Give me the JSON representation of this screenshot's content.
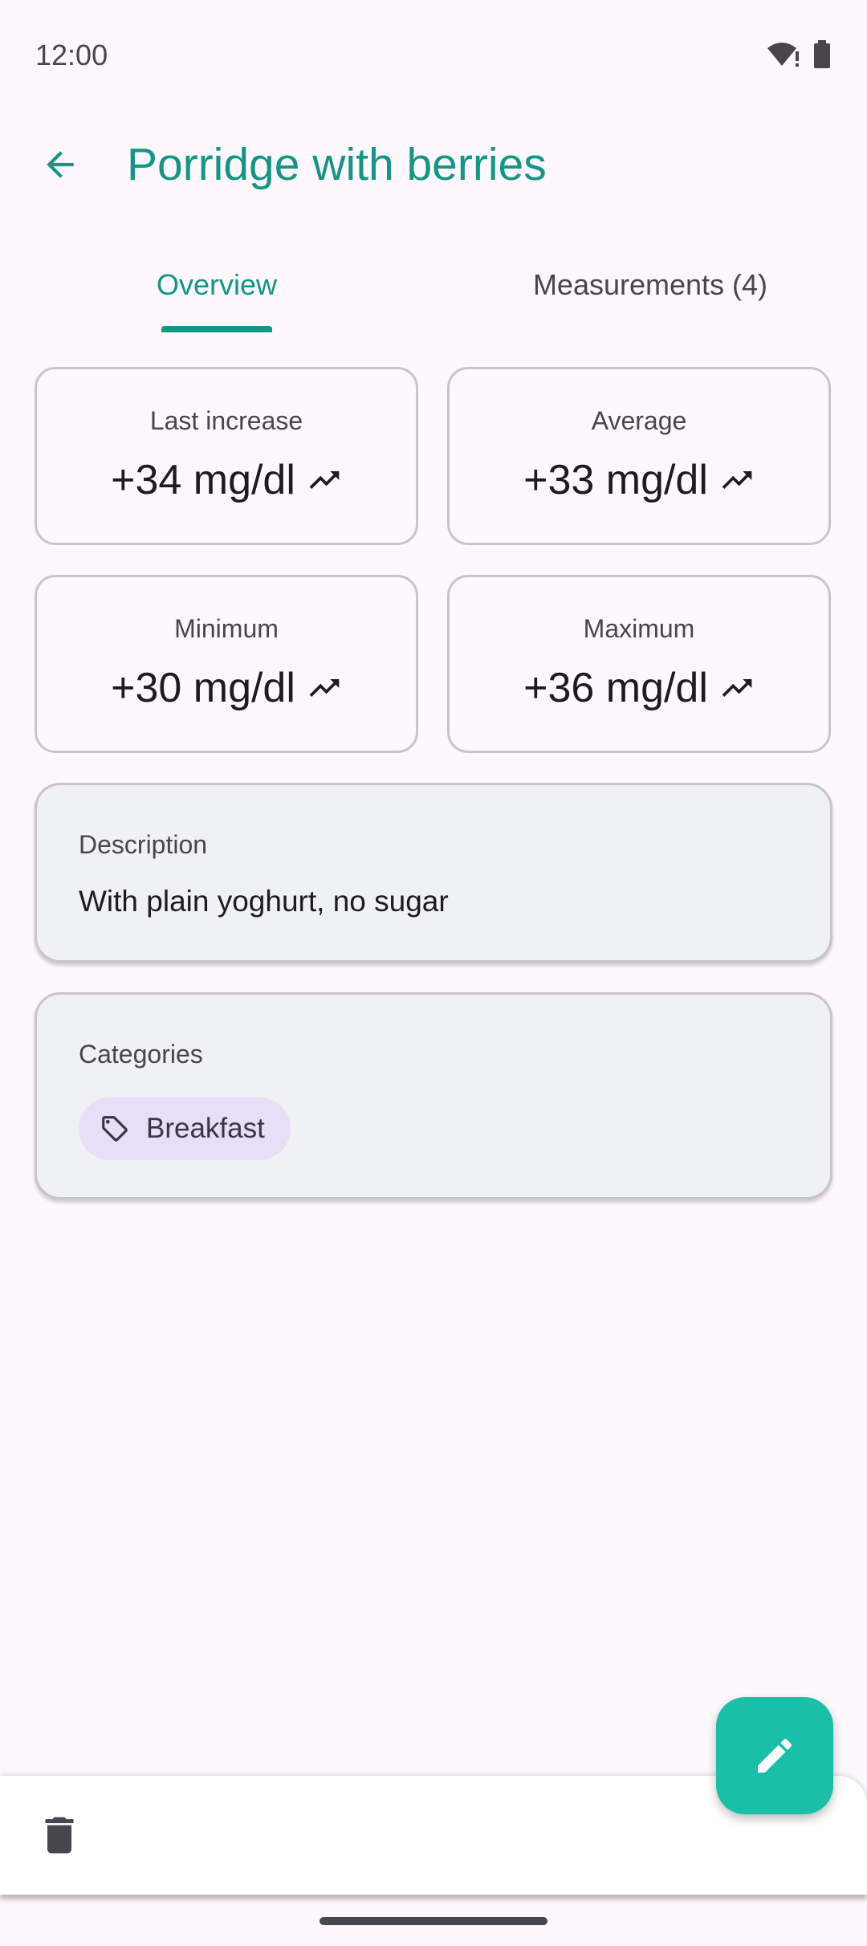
{
  "status": {
    "time": "12:00"
  },
  "app_bar": {
    "title": "Porridge with berries"
  },
  "tabs": [
    {
      "label": "Overview",
      "selected": true
    },
    {
      "label": "Measurements (4)",
      "selected": false
    }
  ],
  "stats": [
    {
      "label": "Last increase",
      "value": "+34 mg/dl"
    },
    {
      "label": "Average",
      "value": "+33 mg/dl"
    },
    {
      "label": "Minimum",
      "value": "+30 mg/dl"
    },
    {
      "label": "Maximum",
      "value": "+36 mg/dl"
    }
  ],
  "description": {
    "label": "Description",
    "text": "With plain yoghurt, no sugar"
  },
  "categories": {
    "label": "Categories",
    "items": [
      "Breakfast"
    ]
  },
  "icons": {
    "back": "arrow-back-icon",
    "trend": "trending-up-icon",
    "tag": "tag-icon",
    "delete": "trash-icon",
    "edit": "pencil-icon",
    "wifi": "wifi-alert-icon",
    "battery": "battery-icon"
  },
  "colors": {
    "accent": "#129686",
    "fab": "#19bfa6",
    "background": "#fef7fc",
    "chip": "#e8def8"
  }
}
